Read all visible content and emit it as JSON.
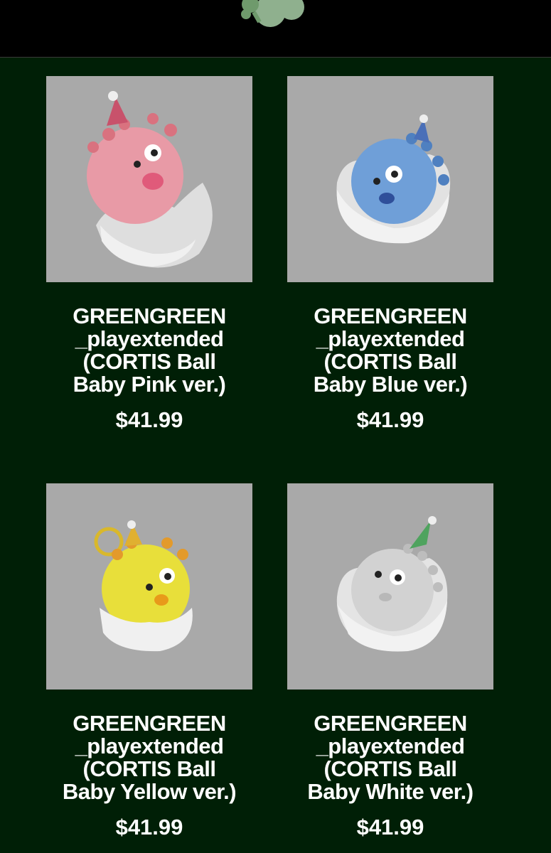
{
  "header": {
    "logo_icon": "clover-logo-icon",
    "right_icons": [
      "account-icon",
      "cart-icon"
    ]
  },
  "products": [
    {
      "title_lines": [
        "GREENGREEN",
        "_playextended",
        "(CORTIS Ball",
        "Baby Pink ver.)"
      ],
      "price": "$41.99",
      "color": "#e89aa6"
    },
    {
      "title_lines": [
        "GREENGREEN",
        "_playextended",
        "(CORTIS Ball",
        "Baby Blue ver.)"
      ],
      "price": "$41.99",
      "color": "#6f9fd8"
    },
    {
      "title_lines": [
        "GREENGREEN",
        "_playextended",
        "(CORTIS Ball",
        "Baby Yellow ver.)"
      ],
      "price": "$41.99",
      "color": "#e8df3a"
    },
    {
      "title_lines": [
        "GREENGREEN",
        "_playextended",
        "(CORTIS Ball",
        "Baby White ver.)"
      ],
      "price": "$41.99",
      "color": "#d2d2d2"
    }
  ]
}
